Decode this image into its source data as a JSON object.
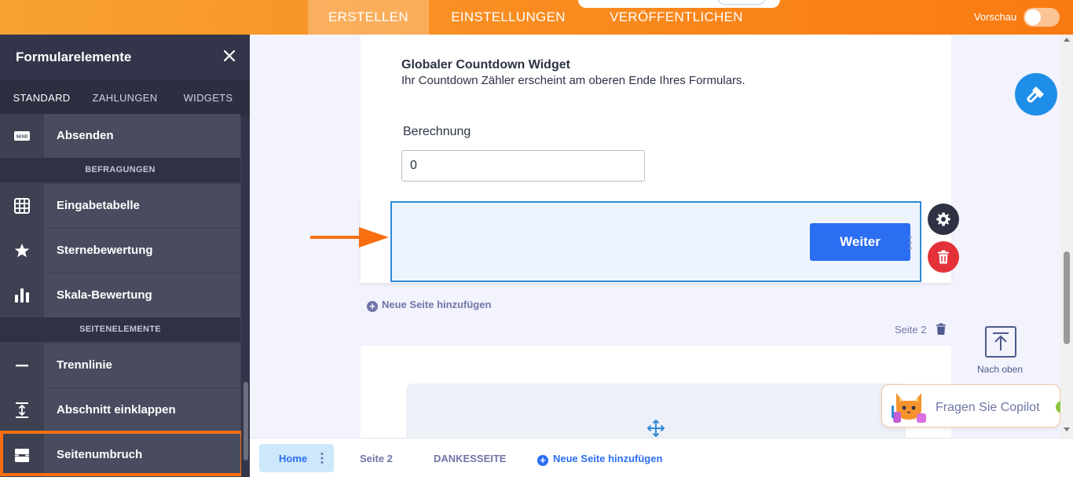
{
  "topbar": {
    "tabs": [
      {
        "label": "ERSTELLEN",
        "active": true
      },
      {
        "label": "EINSTELLUNGEN",
        "active": false
      },
      {
        "label": "VERÖFFENTLICHEN",
        "active": false
      }
    ],
    "preview_label": "Vorschau",
    "preview_enabled": false
  },
  "sidebar": {
    "title": "Formularelemente",
    "tabs": [
      {
        "label": "STANDARD",
        "active": true
      },
      {
        "label": "ZAHLUNGEN",
        "active": false
      },
      {
        "label": "WIDGETS",
        "active": false
      }
    ],
    "items": [
      {
        "label": "Absenden",
        "icon": "send-icon"
      },
      {
        "section": "BEFRAGUNGEN"
      },
      {
        "label": "Eingabetabelle",
        "icon": "table-icon"
      },
      {
        "label": "Sternebewertung",
        "icon": "star-icon"
      },
      {
        "label": "Skala-Bewertung",
        "icon": "bar-chart-icon"
      },
      {
        "section": "SEITENELEMENTE"
      },
      {
        "label": "Trennlinie",
        "icon": "divider-icon"
      },
      {
        "label": "Abschnitt einklappen",
        "icon": "collapse-icon"
      },
      {
        "label": "Seitenumbruch",
        "icon": "page-break-icon",
        "highlighted": true
      }
    ]
  },
  "form": {
    "countdown_title": "Globaler Countdown Widget",
    "countdown_desc": "Ihr Countdown Zähler erscheint am oberen Ende Ihres Formulars.",
    "calc_label": "Berechnung",
    "calc_value": "0",
    "next_button": "Weiter",
    "add_page": "Neue Seite hinzufügen",
    "page2_label": "Seite 2"
  },
  "floating": {
    "nach_oben": "Nach oben",
    "copilot": "Fragen Sie Copilot"
  },
  "bottombar": {
    "home": "Home",
    "page2": "Seite 2",
    "thanks": "DANKESSEITE",
    "add_page": "Neue Seite hinzufügen"
  },
  "colors": {
    "accent_orange": "#f97a12",
    "primary_blue": "#2c6ef2",
    "danger_red": "#e3313a",
    "sidebar_bg": "#3d4152"
  }
}
